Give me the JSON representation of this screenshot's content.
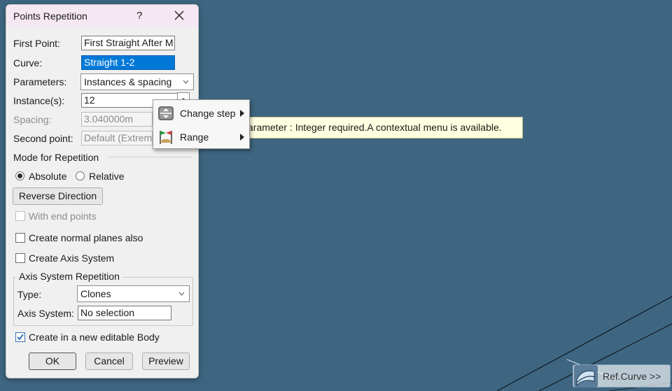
{
  "dialog": {
    "title": "Points Repetition",
    "help": "?",
    "first_point": {
      "label": "First Point:",
      "value": "First Straight After M"
    },
    "curve": {
      "label": "Curve:",
      "value": "Straight 1-2"
    },
    "parameters": {
      "label": "Parameters:",
      "value": "Instances & spacing"
    },
    "instances": {
      "label": "Instance(s):",
      "value": "12"
    },
    "spacing": {
      "label": "Spacing:",
      "value": "3.040000m"
    },
    "second_point": {
      "label": "Second point:",
      "value": "Default (Extrem"
    },
    "mode": {
      "title": "Mode for Repetition",
      "absolute": "Absolute",
      "relative": "Relative",
      "selected": "Absolute"
    },
    "reverse_button": "Reverse Direction",
    "with_end_points": {
      "label": "With end points",
      "checked": false,
      "enabled": false
    },
    "normal_planes": {
      "label": "Create normal planes also",
      "checked": false
    },
    "axis_system": {
      "label": "Create Axis System",
      "checked": false
    },
    "axis_group": {
      "title": "Axis System Repetition",
      "type_label": "Type:",
      "type_value": "Clones",
      "axis_label": "Axis System:",
      "axis_value": "No selection"
    },
    "new_body": {
      "label": "Create in a new editable Body",
      "checked": true
    },
    "buttons": {
      "ok": "OK",
      "cancel": "Cancel",
      "preview": "Preview"
    }
  },
  "tooltip": "arameter : Integer required.A contextual menu is available.",
  "context_menu": {
    "items": [
      {
        "label": "Change step",
        "icon": "change-step-icon"
      },
      {
        "label": "Range",
        "icon": "range-icon"
      }
    ]
  },
  "ref_curve": {
    "label": "Ref.Curve >>",
    "icon": "curve-surface-icon"
  },
  "colors": {
    "background": "#3e6681",
    "selection": "#0078d7",
    "tooltip": "#ffffe1",
    "title_bar": "#f6e8f3"
  }
}
